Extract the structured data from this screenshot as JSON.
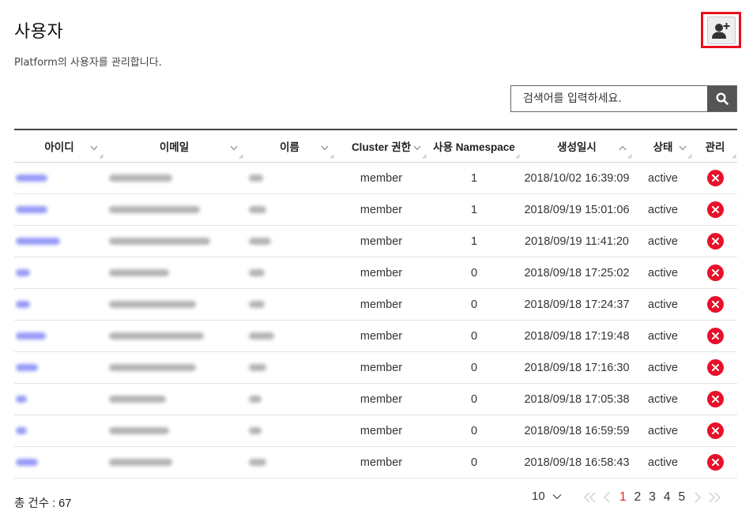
{
  "page": {
    "title": "사용자",
    "description": "Platform의 사용자를 관리합니다."
  },
  "toolbar": {
    "add_user_icon": "add-user-icon"
  },
  "search": {
    "placeholder": "검색어를 입력하세요.",
    "button_icon": "search-icon"
  },
  "table": {
    "columns": [
      {
        "key": "id",
        "label": "아이디",
        "sort": "chevron-down"
      },
      {
        "key": "email",
        "label": "이메일",
        "sort": "chevron-down"
      },
      {
        "key": "name",
        "label": "이름",
        "sort": "chevron-down"
      },
      {
        "key": "cluster_role",
        "label": "Cluster 권한",
        "sort": "chevron-down"
      },
      {
        "key": "namespace",
        "label": "사용 Namespace",
        "sort": ""
      },
      {
        "key": "created",
        "label": "생성일시",
        "sort": "chevron-up"
      },
      {
        "key": "status",
        "label": "상태",
        "sort": "chevron-down"
      },
      {
        "key": "manage",
        "label": "관리",
        "sort": ""
      }
    ],
    "rows": [
      {
        "cluster_role": "member",
        "namespace": "1",
        "created": "2018/10/02 16:39:09",
        "status": "active"
      },
      {
        "cluster_role": "member",
        "namespace": "1",
        "created": "2018/09/19 15:01:06",
        "status": "active"
      },
      {
        "cluster_role": "member",
        "namespace": "1",
        "created": "2018/09/19 11:41:20",
        "status": "active"
      },
      {
        "cluster_role": "member",
        "namespace": "0",
        "created": "2018/09/18 17:25:02",
        "status": "active"
      },
      {
        "cluster_role": "member",
        "namespace": "0",
        "created": "2018/09/18 17:24:37",
        "status": "active"
      },
      {
        "cluster_role": "member",
        "namespace": "0",
        "created": "2018/09/18 17:19:48",
        "status": "active"
      },
      {
        "cluster_role": "member",
        "namespace": "0",
        "created": "2018/09/18 17:16:30",
        "status": "active"
      },
      {
        "cluster_role": "member",
        "namespace": "0",
        "created": "2018/09/18 17:05:38",
        "status": "active"
      },
      {
        "cluster_role": "member",
        "namespace": "0",
        "created": "2018/09/18 16:59:59",
        "status": "active"
      },
      {
        "cluster_role": "member",
        "namespace": "0",
        "created": "2018/09/18 16:58:43",
        "status": "active"
      }
    ],
    "delete_icon": "close-icon"
  },
  "footer": {
    "total_label": "총 건수 : 67",
    "page_size": "10",
    "pages": [
      "1",
      "2",
      "3",
      "4",
      "5"
    ],
    "current_page": "1"
  },
  "colors": {
    "accent_red": "#e8101a",
    "link_blue": "#6b6ff5",
    "delete_red": "#e8102a",
    "search_button": "#555555"
  }
}
